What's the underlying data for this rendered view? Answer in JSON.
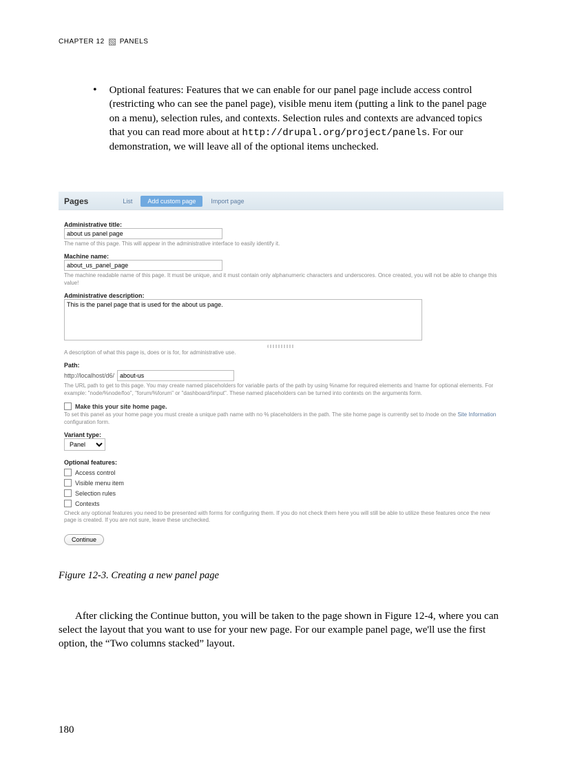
{
  "header": {
    "chapter": "CHAPTER 12",
    "section": "PANELS"
  },
  "bullet": {
    "lead": "Optional features: Features that we can enable for our panel page include access control (restricting who can see the panel page), visible menu item (putting a link to the panel page on a menu), selection rules, and contexts. Selection rules and contexts are advanced topics that you can read more about at ",
    "url": "http://drupal.org/project/panels",
    "tail": ". For our demonstration, we will leave all of the optional items unchecked."
  },
  "shot": {
    "title": "Pages",
    "tabs": {
      "list": "List",
      "add": "Add custom page",
      "import": "Import page"
    },
    "admin_title": {
      "label": "Administrative title:",
      "value": "about us panel page",
      "help": "The name of this page. This will appear in the administrative interface to easily identify it."
    },
    "machine_name": {
      "label": "Machine name:",
      "value": "about_us_panel_page",
      "help": "The machine readable name of this page. It must be unique, and it must contain only alphanumeric characters and underscores. Once created, you will not be able to change this value!"
    },
    "admin_desc": {
      "label": "Administrative description:",
      "value": "This is the panel page that is used for the about us page.",
      "help": "A description of what this page is, does or is for, for administrative use."
    },
    "path": {
      "label": "Path:",
      "prefix": "http://localhost/d6/",
      "value": "about-us",
      "help": "The URL path to get to this page. You may create named placeholders for variable parts of the path by using %name for required elements and !name for optional elements. For example: \"node/%node/foo\", \"forum/%forum\" or \"dashboard/!input\". These named placeholders can be turned into contexts on the arguments form."
    },
    "homepage": {
      "label": "Make this your site home page.",
      "help_a": "To set this panel as your home page you must create a unique path name with no % placeholders in the path. The site home page is currently set to /node on the ",
      "help_link": "Site Information",
      "help_b": " configuration form."
    },
    "variant": {
      "label": "Variant type:",
      "value": "Panel"
    },
    "optional": {
      "label": "Optional features:",
      "items": [
        "Access control",
        "Visible menu item",
        "Selection rules",
        "Contexts"
      ],
      "help": "Check any optional features you need to be presented with forms for configuring them. If you do not check them here you will still be able to utilize these features once the new page is created. If you are not sure, leave these unchecked."
    },
    "continue": "Continue"
  },
  "caption": "Figure 12-3. Creating a new panel page",
  "after": "After clicking the Continue button, you will be taken to the page shown in Figure 12-4, where you can select the layout that you want to use for your new page. For our example panel page, we'll use the first option, the “Two columns stacked” layout.",
  "page_number": "180"
}
